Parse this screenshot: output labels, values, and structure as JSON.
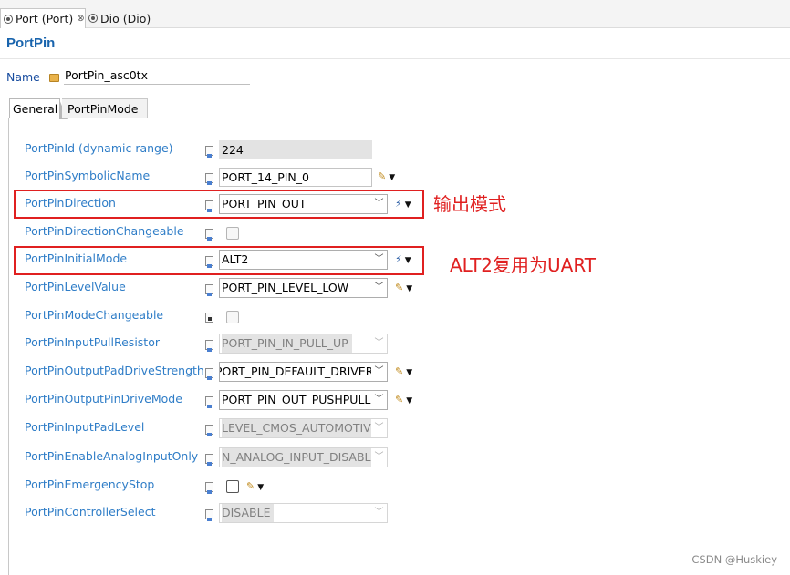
{
  "editor_tabs": [
    {
      "label": "Port (Port)",
      "close": "⊗"
    },
    {
      "label": "Dio (Dio)"
    }
  ],
  "editor_title": "PortPin",
  "name": {
    "label": "Name",
    "value": "PortPin_asc0tx"
  },
  "form_tabs": [
    {
      "label": "General"
    },
    {
      "label": "PortPinMode"
    }
  ],
  "rows": [
    {
      "label": "PortPinId (dynamic range)",
      "value": "224"
    },
    {
      "label": "PortPinSymbolicName",
      "value": "PORT_14_PIN_0"
    },
    {
      "label": "PortPinDirection",
      "value": "PORT_PIN_OUT"
    },
    {
      "label": "PortPinDirectionChangeable"
    },
    {
      "label": "PortPinInitialMode",
      "value": "ALT2"
    },
    {
      "label": "PortPinLevelValue",
      "value": "PORT_PIN_LEVEL_LOW"
    },
    {
      "label": "PortPinModeChangeable"
    },
    {
      "label": "PortPinInputPullResistor",
      "value": "PORT_PIN_IN_PULL_UP"
    },
    {
      "label": "PortPinOutputPadDriveStrength",
      "value": "PORT_PIN_DEFAULT_DRIVER"
    },
    {
      "label": "PortPinOutputPinDriveMode",
      "value": "PORT_PIN_OUT_PUSHPULL"
    },
    {
      "label": "PortPinInputPadLevel",
      "value": "LEVEL_CMOS_AUTOMOTIVE"
    },
    {
      "label": "PortPinEnableAnalogInputOnly",
      "value": "N_ANALOG_INPUT_DISABLE"
    },
    {
      "label": "PortPinEmergencyStop"
    },
    {
      "label": "PortPinControllerSelect",
      "value": "DISABLE"
    }
  ],
  "annotations": [
    {
      "text": "输出模式"
    },
    {
      "text": "ALT2复用为UART"
    }
  ],
  "watermark": "CSDN @Huskiey",
  "colors": {
    "label_blue": "#2f7dc7",
    "title_blue": "#1964ad",
    "highlight_red": "#e02020"
  }
}
